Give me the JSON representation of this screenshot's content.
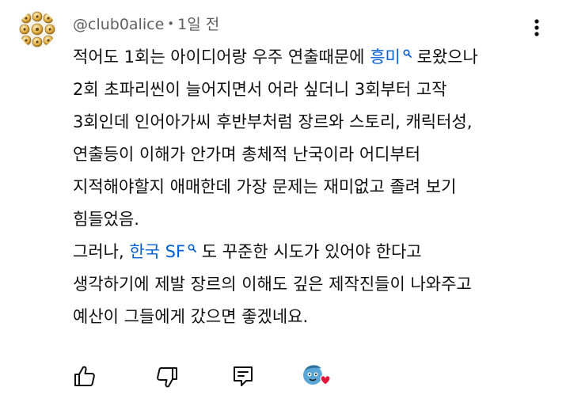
{
  "comment": {
    "author": "@club0alice",
    "separator": "•",
    "time": "1일 전",
    "lines": [
      [
        {
          "t": "적어도 1회는 아이디어랑 우주 연출때문에 "
        },
        {
          "t": "흥미",
          "link": true
        },
        {
          "t": " 로왔으나"
        }
      ],
      [
        {
          "t": "2회 초파리씬이 늘어지면서 어라 싶더니 3회부터 고작"
        }
      ],
      [
        {
          "t": "3회인데 인어아가씨 후반부처럼 장르와 스토리, 캐릭터성,"
        }
      ],
      [
        {
          "t": "연출등이 이해가 안가며 총체적 난국이라 어디부터"
        }
      ],
      [
        {
          "t": "지적해야할지 애매한데 가장 문제는 재미없고 졸려 보기"
        }
      ],
      [
        {
          "t": "힘들었음."
        }
      ],
      [
        {
          "t": "그러나, "
        },
        {
          "t": "한국 SF",
          "link": true
        },
        {
          "t": " 도 꾸준한 시도가 있어야 한다고"
        }
      ],
      [
        {
          "t": "생각하기에 제발 장르의 이해도 깊은 제작진들이 나와주고"
        }
      ],
      [
        {
          "t": "예산이 그들에게 갔으면 좋겠네요."
        }
      ]
    ]
  },
  "icons": {
    "like": "thumbs-up-icon",
    "dislike": "thumbs-down-icon",
    "reply": "reply-comment-icon",
    "creator_heart": "creator-heart-icon",
    "menu": "more-vertical-icon",
    "search": "search-icon"
  },
  "colors": {
    "text": "#0f0f0f",
    "secondary": "#606060",
    "link": "#065fd4",
    "heart": "#e0163c"
  }
}
